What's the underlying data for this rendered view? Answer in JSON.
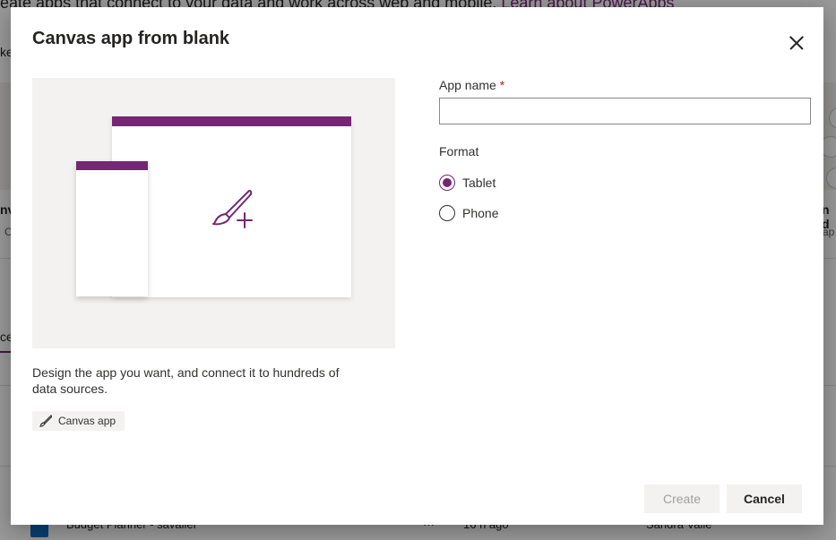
{
  "background": {
    "header_text": "eate apps that connect to your data and work across web and mobile.",
    "header_link": "Learn about PowerApps",
    "left_fragment_1": "ke",
    "left_fragment_2": "nv",
    "left_fragment_3": "C",
    "left_fragment_4": "ce",
    "right_fragment_1": "n d",
    "right_fragment_2": "ap",
    "row": {
      "name": "Budget Planner - savalier",
      "menu": "···",
      "modified": "16 h ago",
      "owner": "Sandra Valle"
    }
  },
  "modal": {
    "title": "Canvas app from blank",
    "description": "Design the app you want, and connect it to hundreds of data sources.",
    "tag_label": "Canvas app",
    "app_name_label": "App name",
    "required_marker": "*",
    "app_name_value": "",
    "format_label": "Format",
    "format_options": [
      {
        "label": "Tablet",
        "selected": true
      },
      {
        "label": "Phone",
        "selected": false
      }
    ],
    "create_label": "Create",
    "cancel_label": "Cancel"
  },
  "colors": {
    "accent": "#742774",
    "required": "#a4262c"
  }
}
